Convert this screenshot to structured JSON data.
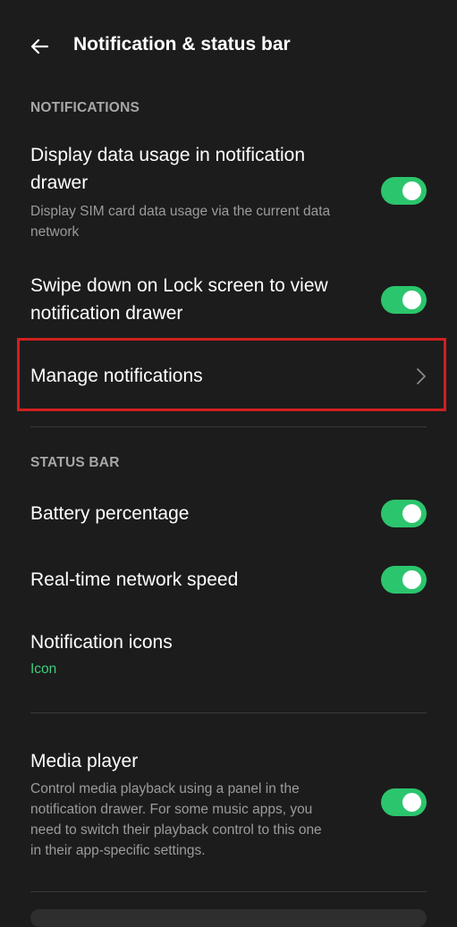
{
  "header": {
    "title": "Notification & status bar",
    "back_icon": "arrow-left-icon"
  },
  "sections": {
    "notifications": "NOTIFICATIONS",
    "status_bar": "STATUS BAR"
  },
  "notifications": {
    "data_usage": {
      "title_line1": "Display data usage in notification",
      "title_line2": "drawer",
      "sub_line1": "Display SIM card data usage via the current data",
      "sub_line2": "network",
      "enabled": true
    },
    "swipe_down": {
      "title_line1": "Swipe down on Lock screen to view",
      "title_line2": "notification drawer",
      "enabled": true
    },
    "manage": {
      "title": "Manage notifications",
      "icon": "chevron-right-icon"
    }
  },
  "status_bar": {
    "battery": {
      "title": "Battery percentage",
      "enabled": true
    },
    "network_speed": {
      "title": "Real-time network speed",
      "enabled": true
    },
    "notification_icons": {
      "title": "Notification icons",
      "value": "Icon"
    }
  },
  "media_player": {
    "title": "Media player",
    "sub_line1": "Control media playback using a panel in the",
    "sub_line2": "notification drawer. For some music apps, you",
    "sub_line3": "need to switch their playback control to this one",
    "sub_line4": "in their app-specific settings.",
    "enabled": true
  },
  "colors": {
    "background": "#1c1c1c",
    "accent": "#2bc56d",
    "highlight": "#d11f1f"
  }
}
